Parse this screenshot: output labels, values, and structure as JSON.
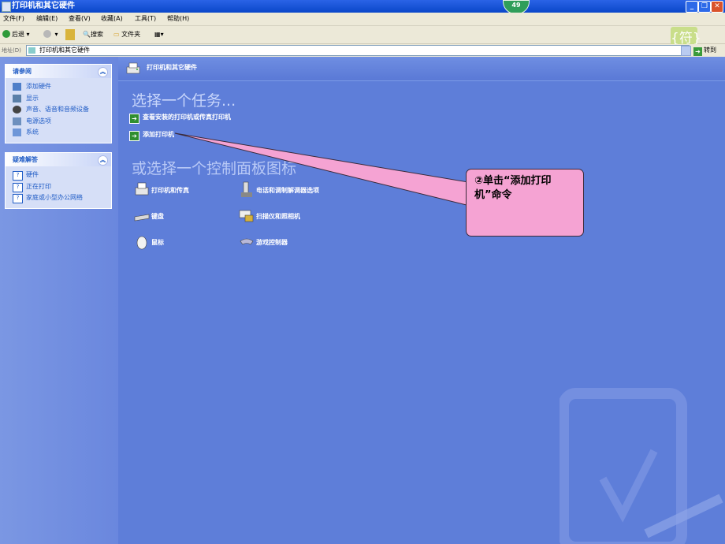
{
  "window": {
    "title": "打印机和其它硬件",
    "badge": "49",
    "minimize_icon": "minimize-icon",
    "maximize_icon": "maximize-icon",
    "close_icon": "close-icon"
  },
  "menu": [
    "文件(F)",
    "编辑(E)",
    "查看(V)",
    "收藏(A)",
    "工具(T)",
    "帮助(H)"
  ],
  "toolbar": {
    "back_label": "后退",
    "search_label": "搜索",
    "folders_label": "文件夹"
  },
  "address": {
    "label": "地址(D)",
    "value": "打印机和其它硬件",
    "go_label": "转到"
  },
  "symbol_badge": "{符}",
  "sidebar": {
    "see_also": {
      "title": "请参阅",
      "items": [
        "添加硬件",
        "显示",
        "声音、语音和音频设备",
        "电源选项",
        "系统"
      ]
    },
    "troubleshoot": {
      "title": "疑难解答",
      "items": [
        "硬件",
        "正在打印",
        "家庭或小型办公网络"
      ]
    }
  },
  "content": {
    "header": "打印机和其它硬件",
    "task_heading": "选择一个任务...",
    "tasks": [
      "查看安装的打印机或传真打印机",
      "添加打印机"
    ],
    "cp_heading": "或选择一个控制面板图标",
    "icons": [
      "打印机和传真",
      "电话和调制解调器选项",
      "键盘",
      "扫描仪和照相机",
      "鼠标",
      "游戏控制器"
    ]
  },
  "callout": {
    "text": "②单击“添加打印机”命令"
  }
}
